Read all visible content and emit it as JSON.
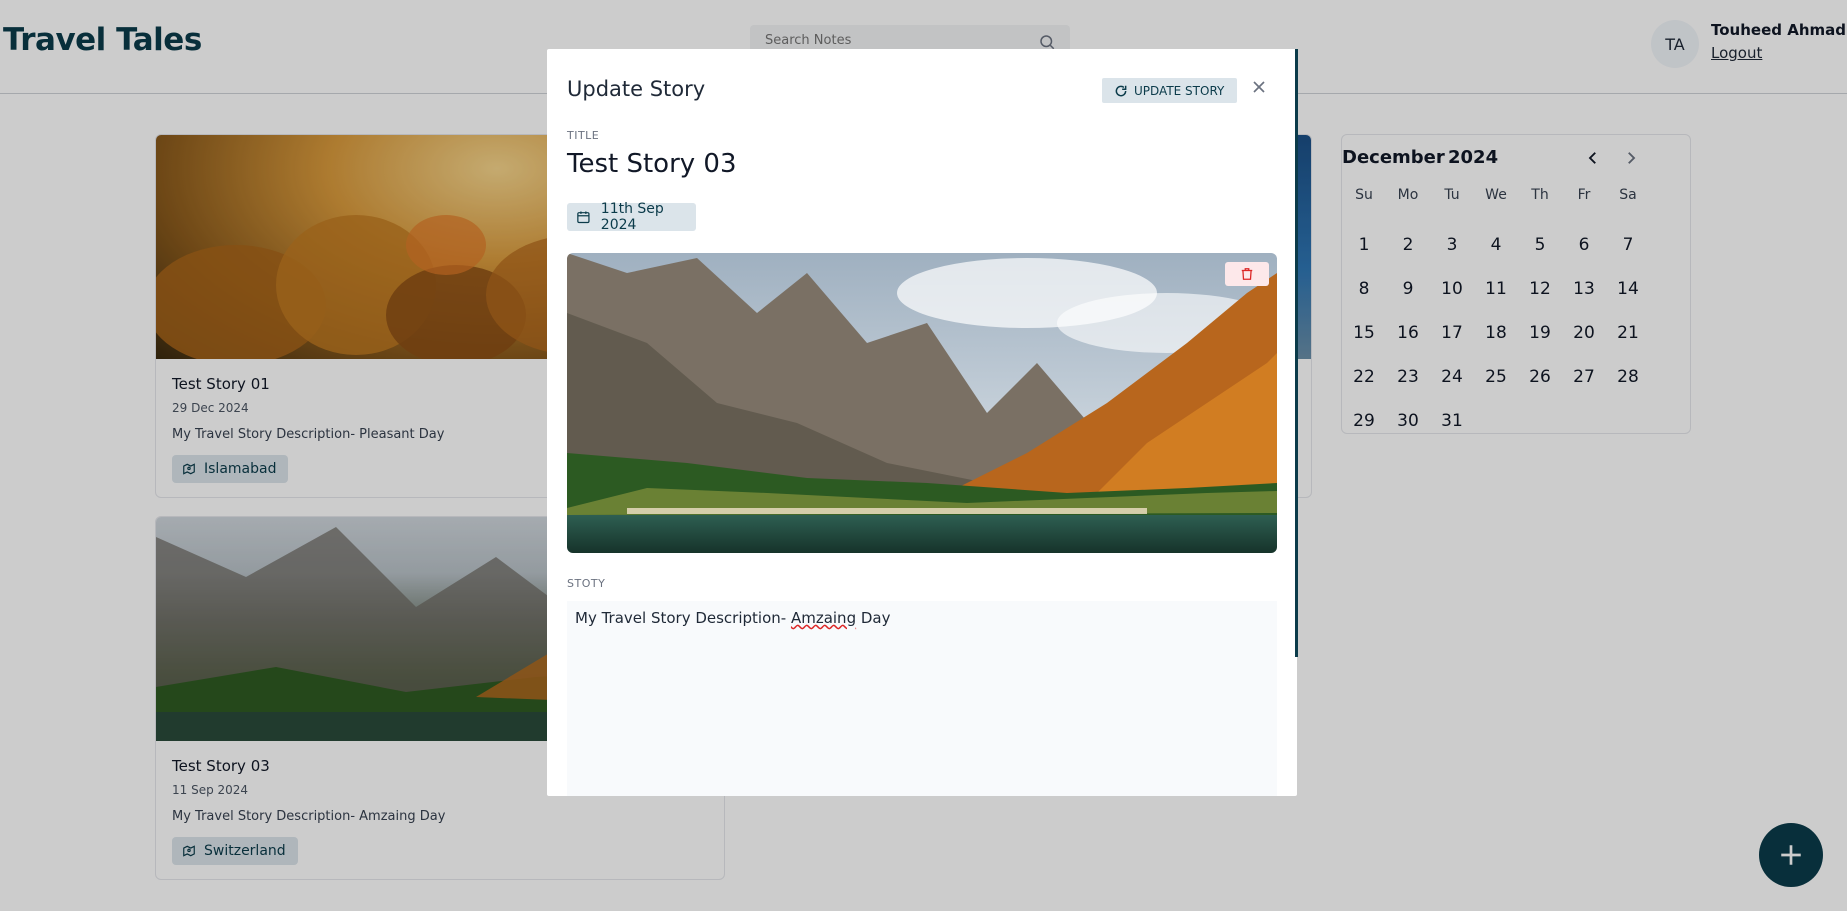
{
  "app": {
    "logo": "Travel Tales"
  },
  "search": {
    "placeholder": "Search Notes"
  },
  "user": {
    "initials": "TA",
    "name": "Touheed Ahmad",
    "logout_label": "Logout"
  },
  "stories": [
    {
      "title": "Test Story 01",
      "date": "29 Dec 2024",
      "description": "My Travel Story Description- Pleasant Day",
      "location": "Islamabad"
    },
    {
      "title": "Test Story 03",
      "date": "11 Sep 2024",
      "description": "My Travel Story Description- Amzaing Day",
      "location": "Switzerland"
    }
  ],
  "calendar": {
    "month": "December",
    "year": "2024",
    "weekdays": [
      "Su",
      "Mo",
      "Tu",
      "We",
      "Th",
      "Fr",
      "Sa"
    ],
    "days": [
      "1",
      "2",
      "3",
      "4",
      "5",
      "6",
      "7",
      "8",
      "9",
      "10",
      "11",
      "12",
      "13",
      "14",
      "15",
      "16",
      "17",
      "18",
      "19",
      "20",
      "21",
      "22",
      "23",
      "24",
      "25",
      "26",
      "27",
      "28",
      "29",
      "30",
      "31"
    ]
  },
  "modal": {
    "heading": "Update Story",
    "update_button_label": "UPDATE STORY",
    "title_label": "TITLE",
    "title_value": "Test Story 03",
    "date_label": "11th Sep 2024",
    "story_label": "STOTY",
    "story_text_before": "My Travel Story Description- ",
    "story_text_typo": "Amzaing",
    "story_text_after": " Day"
  },
  "fab": {
    "icon": "plus-icon"
  },
  "colors": {
    "brand": "#0b3b4a",
    "chip_bg": "#dbe4ea",
    "delete_bg": "#fde8ea",
    "delete_icon": "#dc2626"
  }
}
